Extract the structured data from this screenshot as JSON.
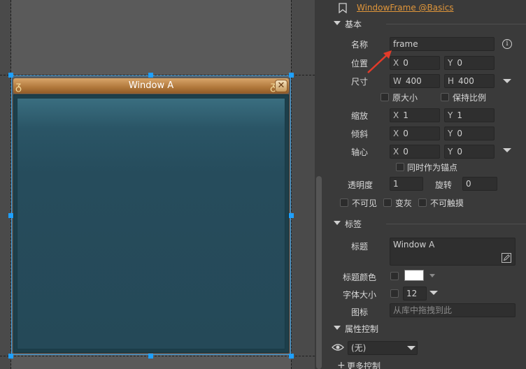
{
  "header": {
    "component_link": "WindowFrame @Basics"
  },
  "window_preview": {
    "title": "Window A",
    "close_glyph": "✕",
    "ornament_glyph": "ᵹ"
  },
  "sections": {
    "basic": {
      "title": "基本"
    },
    "label": {
      "title": "标签"
    },
    "property_control": {
      "title": "属性控制"
    },
    "more_control": {
      "title": "更多控制"
    }
  },
  "basic": {
    "name_label": "名称",
    "name_value": "frame",
    "position_label": "位置",
    "position_x_axis": "X",
    "position_x": "0",
    "position_y_axis": "Y",
    "position_y": "0",
    "size_label": "尺寸",
    "size_w_axis": "W",
    "size_w": "400",
    "size_h_axis": "H",
    "size_h": "400",
    "original_size_label": "原大小",
    "keep_ratio_label": "保持比例",
    "scale_label": "缩放",
    "scale_x_axis": "X",
    "scale_x": "1",
    "scale_y_axis": "Y",
    "scale_y": "1",
    "skew_label": "倾斜",
    "skew_x_axis": "X",
    "skew_x": "0",
    "skew_y_axis": "Y",
    "skew_y": "0",
    "pivot_label": "轴心",
    "pivot_x_axis": "X",
    "pivot_x": "0",
    "pivot_y_axis": "Y",
    "pivot_y": "0",
    "anchor_label": "同时作为锚点",
    "alpha_label": "透明度",
    "alpha_value": "1",
    "rotation_label": "旋转",
    "rotation_value": "0",
    "invisible_label": "不可见",
    "gray_label": "变灰",
    "untouchable_label": "不可触摸"
  },
  "label_section": {
    "title_label": "标题",
    "title_value": "Window A",
    "title_color_label": "标题颜色",
    "title_color": "#ffffff",
    "font_size_label": "字体大小",
    "font_size_value": "12",
    "icon_label": "图标",
    "icon_placeholder": "从库中拖拽到此"
  },
  "property_control": {
    "gear_value": "(无)"
  },
  "icons": {
    "bookmark": "bookmark-icon",
    "info": "info-icon",
    "edit": "edit-icon",
    "eye": "eye-icon",
    "plus": "plus-icon"
  },
  "colors": {
    "accent": "#e0963a",
    "selection": "#1ea0ff",
    "window_title": "#b0773a",
    "window_body": "#254958"
  }
}
